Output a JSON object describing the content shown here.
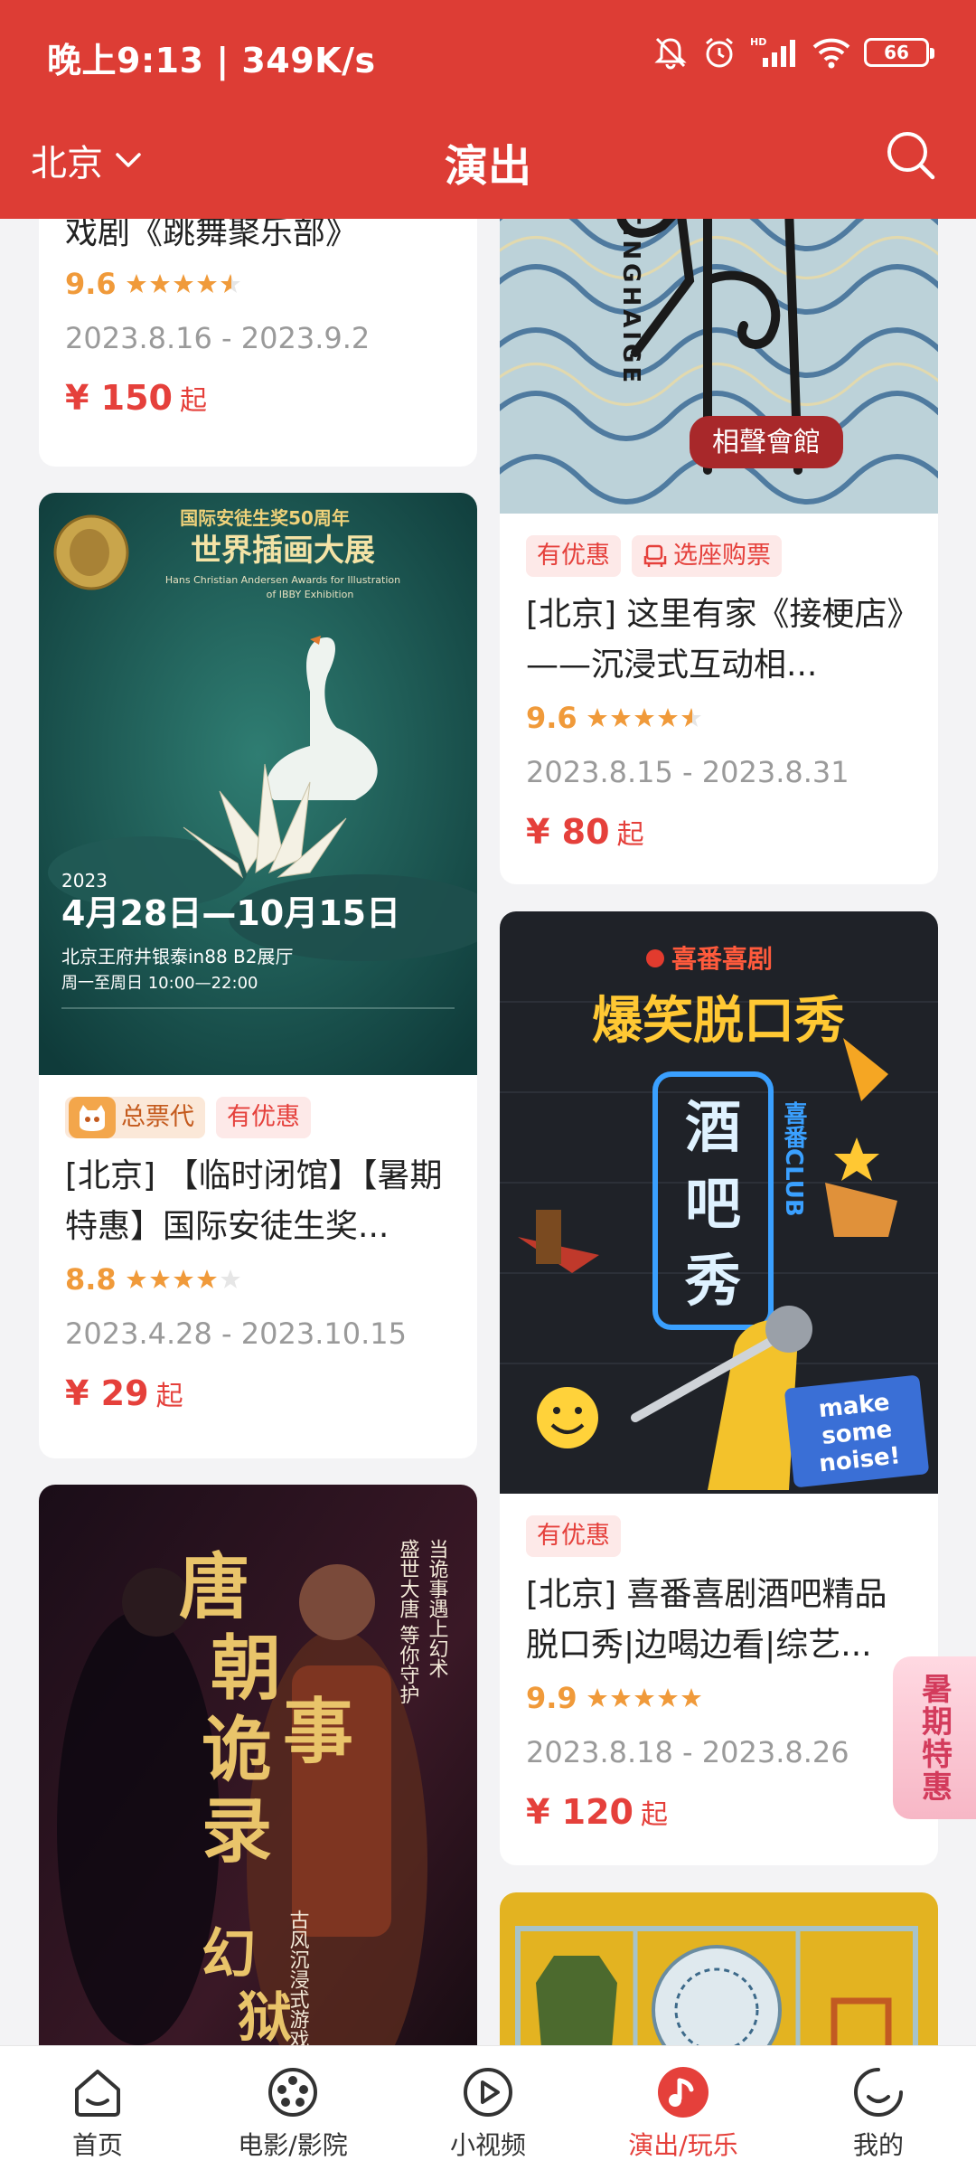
{
  "status_bar": {
    "time": "晚上9:13 | 349K/s",
    "battery": "66"
  },
  "nav": {
    "city": "北京",
    "title": "演出"
  },
  "cards": {
    "dance": {
      "title": "戏剧《跳舞聚乐部》",
      "score": "9.6",
      "stars": 4.5,
      "date": "2023.8.16 - 2023.9.2",
      "price": "¥ 150",
      "price_suffix": "起"
    },
    "tinghaige": {
      "poster": {
        "latin": "TINGHAIGE",
        "seal": "相聲會館"
      },
      "tags": [
        "有优惠",
        "选座购票"
      ],
      "title": "[北京] 这里有家《接梗店》——沉浸式互动相...",
      "score": "9.6",
      "stars": 4.5,
      "date": "2023.8.15 - 2023.8.31",
      "price": "¥ 80",
      "price_suffix": "起"
    },
    "andersen": {
      "poster": {
        "line1": "国际安徒生奖50周年",
        "line2": "世界插画大展",
        "line3": "Hans Christian Andersen Awards for Illustration",
        "line4": "of IBBY Exhibition",
        "year": "2023",
        "dates": "4月28日—10月15日",
        "venue": "北京王府井银泰in88 B2展厅",
        "hours": "周一至周日  10:00—22:00"
      },
      "tags": [
        "总票代",
        "有优惠"
      ],
      "title": "[北京] 【临时闭馆】【暑期特惠】国际安徒生奖...",
      "score": "8.8",
      "stars": 4,
      "date": "2023.4.28 - 2023.10.15",
      "price": "¥ 29",
      "price_suffix": "起"
    },
    "xifan": {
      "poster": {
        "brand": "喜番喜剧",
        "headline": "爆笑脱口秀",
        "sign1": "酒",
        "sign2": "吧",
        "sign3": "秀",
        "side": "喜番CLUB",
        "noise1": "make",
        "noise2": "some",
        "noise3": "noise!"
      },
      "tags": [
        "有优惠"
      ],
      "title": "[北京] 喜番喜剧酒吧精品脱口秀|边喝边看|综艺...",
      "score": "9.9",
      "stars": 5,
      "date": "2023.8.18 - 2023.8.26",
      "price": "¥ 120",
      "price_suffix": "起"
    },
    "tang": {
      "poster": {
        "title": "唐朝诡事录",
        "sub": "幻狱变",
        "col1": "当诡事遇上幻术",
        "col2": "盛世大唐 等你守护",
        "col3": "古风沉浸式游戏剧场"
      }
    }
  },
  "summer_badge": "暑期特惠",
  "bottom_nav": [
    {
      "label": "首页",
      "icon": "home-icon"
    },
    {
      "label": "电影/影院",
      "icon": "film-reel-icon"
    },
    {
      "label": "小视频",
      "icon": "play-icon"
    },
    {
      "label": "演出/玩乐",
      "icon": "music-note-icon",
      "active": true
    },
    {
      "label": "我的",
      "icon": "profile-icon"
    }
  ],
  "colors": {
    "brand_red": "#dd3d35",
    "price_red": "#e5403b",
    "score_orange": "#f09a3a"
  }
}
